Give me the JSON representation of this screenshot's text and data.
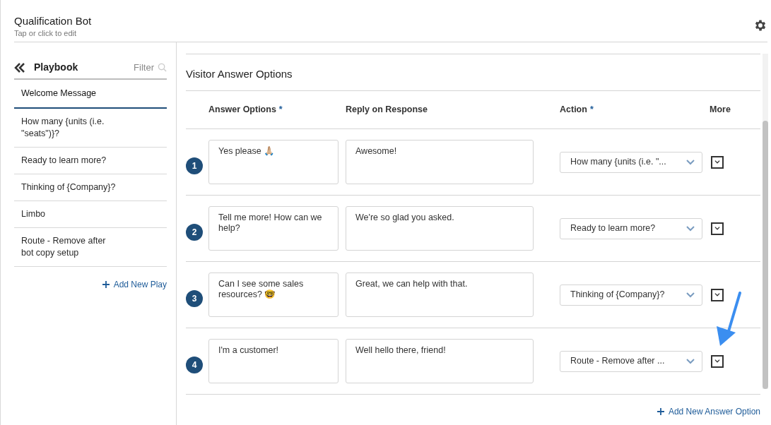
{
  "header": {
    "title": "Qualification Bot",
    "subtitle": "Tap or click to edit"
  },
  "sidebar": {
    "title": "Playbook",
    "filter_placeholder": "Filter",
    "items": [
      {
        "label": "Welcome Message",
        "selected": true
      },
      {
        "label": "How many {units (i.e. \"seats\")}?",
        "selected": false
      },
      {
        "label": "Ready to learn more?",
        "selected": false
      },
      {
        "label": "Thinking of {Company}?",
        "selected": false
      },
      {
        "label": "Limbo",
        "selected": false
      },
      {
        "label": "Route - Remove after bot copy setup",
        "selected": false
      }
    ],
    "add_button": "Add New Play"
  },
  "section": {
    "title": "Visitor Answer Options",
    "columns": [
      {
        "label": "Answer Options",
        "mark": "*"
      },
      {
        "label": "Reply on Response"
      },
      {
        "label": "Action",
        "mark": "*"
      },
      {
        "label": "More"
      }
    ],
    "rows": [
      {
        "number": "1",
        "answer": "Yes please 🙏🏼",
        "reply": "Awesome!",
        "action": "How many {units (i.e. \"..."
      },
      {
        "number": "2",
        "answer": "Tell me more! How can we help?",
        "reply": "We're so glad you asked.",
        "action": "Ready to learn more?"
      },
      {
        "number": "3",
        "answer": "Can I see some sales resources? 🤓",
        "reply": "Great, we can help with that.",
        "action": "Thinking of {Company}?"
      },
      {
        "number": "4",
        "answer": "I'm a customer!",
        "reply": "Well hello there, friend!",
        "action": "Route - Remove after ..."
      }
    ],
    "add_button": "Add New Answer Option"
  }
}
